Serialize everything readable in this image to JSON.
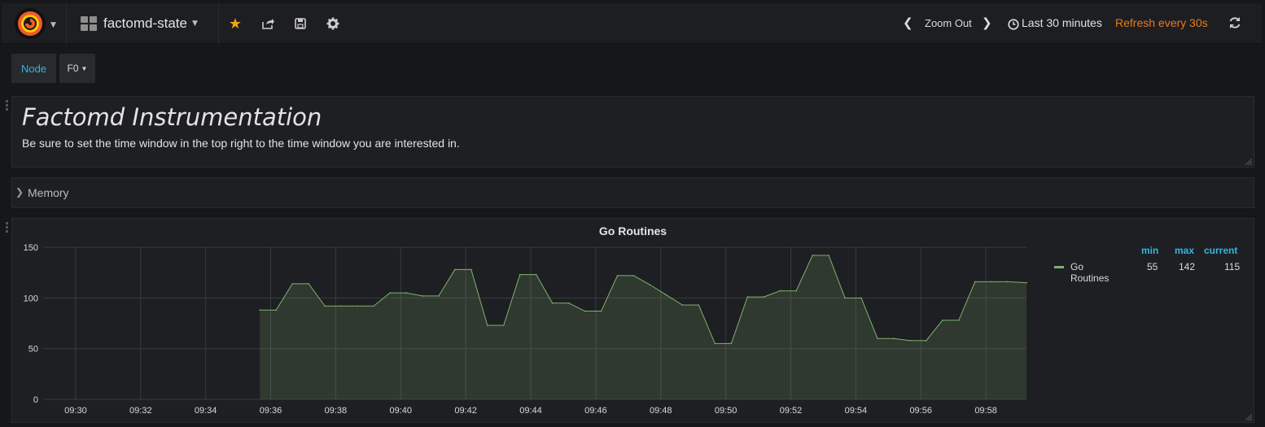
{
  "navbar": {
    "dashboard_title": "factomd-state",
    "zoom_label": "Zoom Out",
    "time_range": "Last 30 minutes",
    "refresh": "Refresh every 30s"
  },
  "variables": {
    "label": "Node",
    "selected": "F0"
  },
  "text_panel": {
    "title": "Factomd Instrumentation",
    "body": "Be sure to set the time window in the top right to the time window you are interested in."
  },
  "row": {
    "title": "Memory"
  },
  "graph": {
    "title": "Go Routines",
    "legend_headers": {
      "min": "min",
      "max": "max",
      "current": "current"
    },
    "legend_series": {
      "name": "Go Routines",
      "min": "55",
      "max": "142",
      "current": "115"
    }
  },
  "colors": {
    "series": "#7eb26d",
    "accent": "#33b5e5",
    "refresh": "#eb7b18",
    "star": "#f2a30f"
  },
  "icons": [
    "grafana-logo-icon",
    "dashboard-grid-icon",
    "star-icon",
    "share-icon",
    "save-icon",
    "settings-gear-icon",
    "chevron-left-icon",
    "chevron-right-icon",
    "clock-icon",
    "refresh-icon",
    "chevron-right-row-icon"
  ],
  "chart_data": {
    "type": "area",
    "title": "Go Routines",
    "ylim": [
      0,
      150
    ],
    "yticks": [
      0,
      50,
      100,
      150
    ],
    "xticks": [
      "09:30",
      "09:32",
      "09:34",
      "09:36",
      "09:38",
      "09:40",
      "09:42",
      "09:44",
      "09:46",
      "09:48",
      "09:50",
      "09:52",
      "09:54",
      "09:56",
      "09:58"
    ],
    "xlim": [
      "09:29:00",
      "09:59:15"
    ],
    "grid": true,
    "legend": "right",
    "series": [
      {
        "name": "Go Routines",
        "x": [
          "09:35:40",
          "09:36:10",
          "09:36:40",
          "09:37:10",
          "09:37:40",
          "09:38:10",
          "09:38:40",
          "09:39:10",
          "09:39:40",
          "09:40:10",
          "09:40:40",
          "09:41:10",
          "09:41:40",
          "09:42:10",
          "09:42:40",
          "09:43:10",
          "09:43:40",
          "09:44:10",
          "09:44:40",
          "09:45:10",
          "09:45:40",
          "09:46:10",
          "09:46:40",
          "09:47:10",
          "09:47:40",
          "09:48:10",
          "09:48:40",
          "09:49:10",
          "09:49:40",
          "09:50:10",
          "09:50:40",
          "09:51:10",
          "09:51:40",
          "09:52:10",
          "09:52:40",
          "09:53:10",
          "09:53:40",
          "09:54:10",
          "09:54:40",
          "09:55:10",
          "09:55:40",
          "09:56:10",
          "09:56:40",
          "09:57:10",
          "09:57:40",
          "09:58:10",
          "09:58:40",
          "09:59:15"
        ],
        "values": [
          88,
          88,
          114,
          114,
          92,
          92,
          92,
          92,
          105,
          105,
          102,
          102,
          128,
          128,
          73,
          73,
          123,
          123,
          95,
          95,
          87,
          87,
          122,
          122,
          113,
          103,
          93,
          93,
          55,
          55,
          101,
          101,
          107,
          107,
          142,
          142,
          100,
          100,
          60,
          60,
          58,
          58,
          78,
          78,
          116,
          116,
          116,
          115
        ]
      }
    ]
  }
}
